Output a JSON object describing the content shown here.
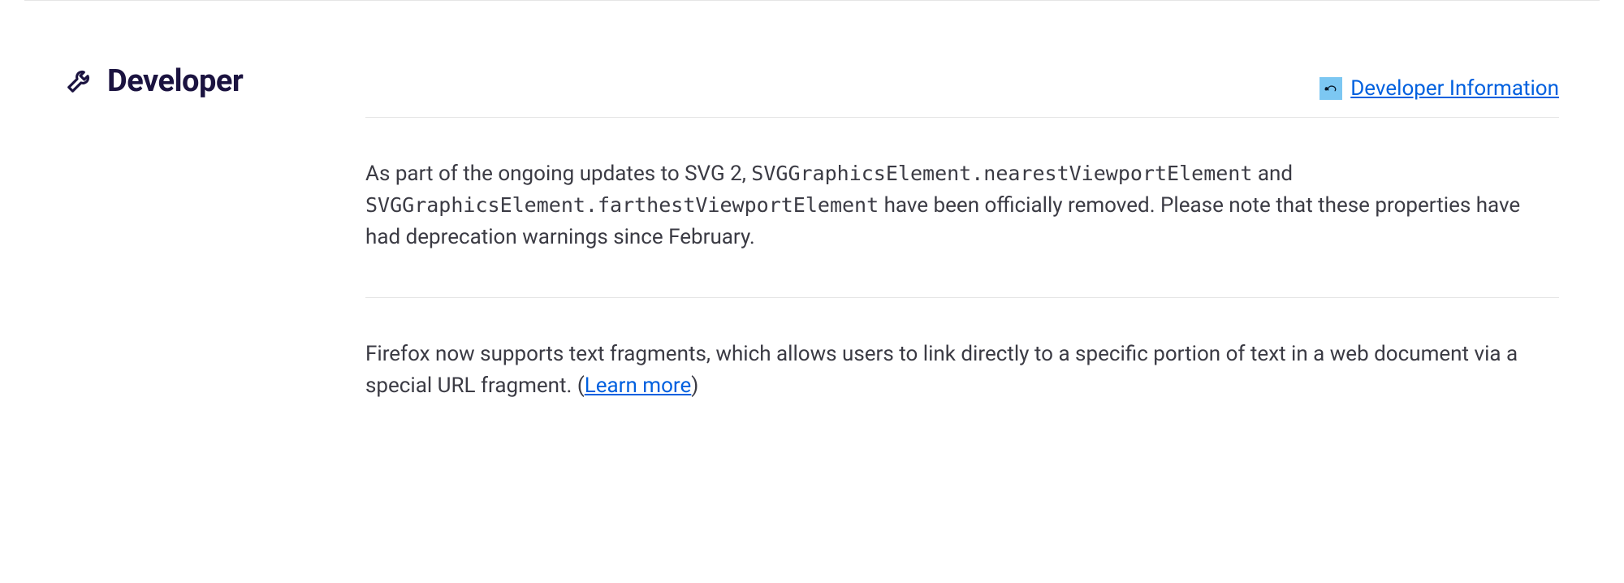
{
  "section": {
    "title": "Developer"
  },
  "devInfo": {
    "label": "Developer Information"
  },
  "entry1": {
    "part1": "As part of the ongoing updates to SVG 2, ",
    "code1": "SVGGraphicsElement.nearestViewportElement",
    "part2": " and ",
    "code2": "SVGGraphicsElement.farthestViewportElement",
    "part3": " have been officially removed. Please note that these properties have had deprecation warnings since February."
  },
  "entry2": {
    "part1": "Firefox now supports text fragments, which allows users to link directly to a specific portion of text in a web document via a special URL fragment. (",
    "linkText": "Learn more",
    "part2": ")"
  }
}
